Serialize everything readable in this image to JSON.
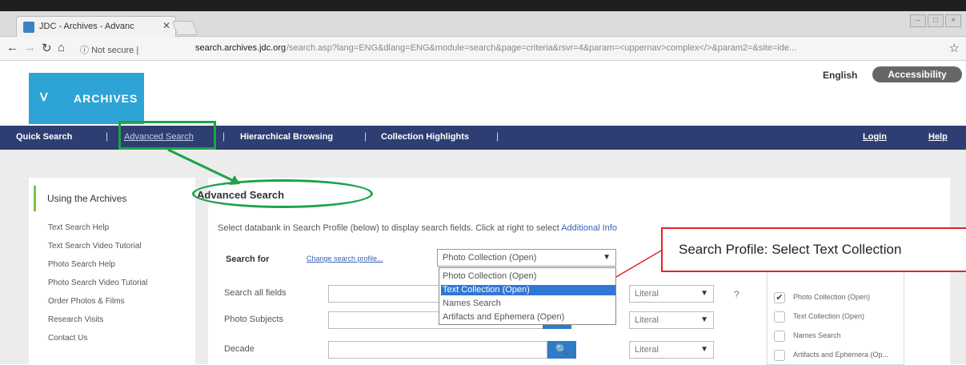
{
  "browser": {
    "tab_title": "JDC - Archives - Advanc",
    "close_glyph": "✕",
    "secure_label": "Not secure",
    "url_domain": "search.archives.jdc.org",
    "url_path": "/search.asp?lang=ENG&dlang=ENG&module=search&page=criteria&rsvr=4&param=<uppernav>complex</>&param2=&site=ide...",
    "window_buttons": [
      "",
      "",
      ""
    ]
  },
  "header": {
    "logo_glyph": "ᐯ",
    "logo_text": "ARCHIVES",
    "language": "English",
    "accessibility": "Accessibility"
  },
  "nav": {
    "quick_search": "Quick Search",
    "advanced_search": "Advanced Search",
    "hierarchical_browsing": "Hierarchical Browsing",
    "collection_highlights": "Collection Highlights",
    "login": "Login",
    "help": "Help",
    "separator": "|"
  },
  "sidebar": {
    "heading": "Using the Archives",
    "links": [
      "Text Search Help",
      "Text Search Video Tutorial",
      "Photo Search Help",
      "Photo Search Video Tutorial",
      "Order Photos & Films",
      "Research Visits",
      "Contact Us"
    ]
  },
  "main": {
    "title": "Advanced Search",
    "instructions": "Select databank in Search Profile (below) to display search fields. Click at right to select ",
    "instructions_link": "Additional Info",
    "search_for_label": "Search for",
    "change_profile": "Change search profile...",
    "profile_selected": "Photo Collection (Open)",
    "profile_options": [
      "Photo Collection (Open)",
      "Text Collection (Open)",
      "Names Search",
      "Artifacts and Ephemera (Open)"
    ],
    "highlighted_option_index": 1,
    "fields": [
      {
        "label": "Search all fields",
        "mode": "Literal"
      },
      {
        "label": "Photo Subjects",
        "mode": "Literal"
      },
      {
        "label": "Decade",
        "mode": "Literal"
      }
    ],
    "help_mark": "?",
    "search_glyph": "🔍",
    "dropdown_arrow": "▼"
  },
  "databanks": [
    {
      "label": "Photo Collection (Open)",
      "checked": true
    },
    {
      "label": "Text Collection (Open)",
      "checked": false
    },
    {
      "label": "Names Search",
      "checked": false
    },
    {
      "label": "Artifacts and Ephemera (Op...",
      "checked": false
    }
  ],
  "annotation": {
    "callout_text": "Search Profile: Select Text Collection",
    "highlight_color": "#1ea24a",
    "callout_color": "#e0252a"
  }
}
